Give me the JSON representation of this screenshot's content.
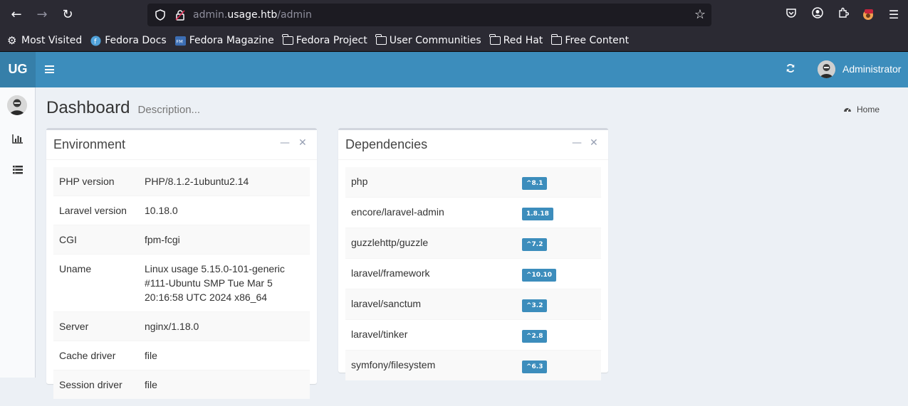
{
  "browser": {
    "url_prefix": "admin.",
    "url_host": "usage.htb",
    "url_path": "/admin",
    "bookmarks": [
      {
        "label": "Most Visited",
        "icon": "gear-icon"
      },
      {
        "label": "Fedora Docs",
        "icon": "fedora-icon"
      },
      {
        "label": "Fedora Magazine",
        "icon": "fedora-magazine-icon"
      },
      {
        "label": "Fedora Project",
        "icon": "folder-icon"
      },
      {
        "label": "User Communities",
        "icon": "folder-icon"
      },
      {
        "label": "Red Hat",
        "icon": "folder-icon"
      },
      {
        "label": "Free Content",
        "icon": "folder-icon"
      }
    ]
  },
  "header": {
    "logo": "UG",
    "user_name": "Administrator",
    "accent": "#3c8dbc"
  },
  "page": {
    "title": "Dashboard",
    "description": "Description...",
    "breadcrumb": "Home"
  },
  "environment": {
    "title": "Environment",
    "rows": [
      {
        "name": "PHP version",
        "value": "PHP/8.1.2-1ubuntu2.14"
      },
      {
        "name": "Laravel version",
        "value": "10.18.0"
      },
      {
        "name": "CGI",
        "value": "fpm-fcgi"
      },
      {
        "name": "Uname",
        "value": "Linux usage 5.15.0-101-generic #111-Ubuntu SMP Tue Mar 5 20:16:58 UTC 2024 x86_64"
      },
      {
        "name": "Server",
        "value": "nginx/1.18.0"
      },
      {
        "name": "Cache driver",
        "value": "file"
      },
      {
        "name": "Session driver",
        "value": "file"
      }
    ]
  },
  "dependencies": {
    "title": "Dependencies",
    "rows": [
      {
        "name": "php",
        "version": "^8.1"
      },
      {
        "name": "encore/laravel-admin",
        "version": "1.8.18"
      },
      {
        "name": "guzzlehttp/guzzle",
        "version": "^7.2"
      },
      {
        "name": "laravel/framework",
        "version": "^10.10"
      },
      {
        "name": "laravel/sanctum",
        "version": "^3.2"
      },
      {
        "name": "laravel/tinker",
        "version": "^2.8"
      },
      {
        "name": "symfony/filesystem",
        "version": "^6.3"
      }
    ]
  }
}
